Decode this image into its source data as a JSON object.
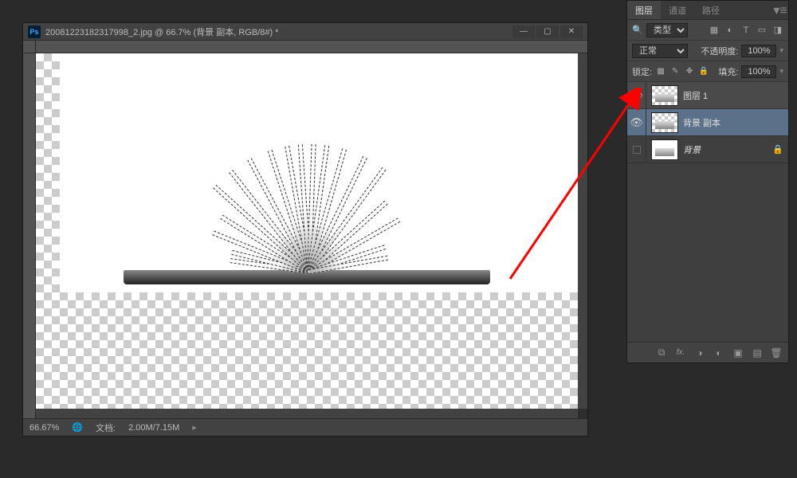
{
  "document": {
    "title": "20081223182317998_2.jpg @ 66.7% (背景 副本, RGB/8#) *",
    "zoom_display": "66.67%",
    "status_doc_label": "文档:",
    "status_doc_value": "2.00M/7.15M"
  },
  "window_controls": {
    "minimize": "—",
    "maximize": "▢",
    "close": "✕"
  },
  "panel": {
    "tabs": {
      "layers": "图层",
      "channels": "通道",
      "paths": "路径"
    },
    "filter_row": {
      "kind_label": "类型"
    },
    "blend_row": {
      "mode": "正常",
      "opacity_label": "不透明度:",
      "opacity_value": "100%"
    },
    "lock_row": {
      "label": "锁定:",
      "fill_label": "填充:",
      "fill_value": "100%"
    },
    "layers": [
      {
        "name": "图层 1",
        "visible": true,
        "locked": false,
        "italic": false
      },
      {
        "name": "背景 副本",
        "visible": true,
        "locked": false,
        "italic": false
      },
      {
        "name": "背景",
        "visible": false,
        "locked": true,
        "italic": true
      }
    ]
  },
  "icons": {
    "eye": "👁",
    "lock": "🔒",
    "search": "🔍",
    "link": "⧉",
    "fx": "fx.",
    "mask": "◑",
    "adjust": "◐",
    "folder": "▣",
    "new": "▤",
    "trash": "🗑",
    "image_filter": "▦",
    "adjust_filter": "◐",
    "text_filter": "T",
    "shape_filter": "▭",
    "smart_filter": "◨",
    "lock_trans": "▩",
    "lock_brush": "✎",
    "lock_move": "✥",
    "lock_all": "🔒",
    "arrow": "▾",
    "play": "▸"
  }
}
